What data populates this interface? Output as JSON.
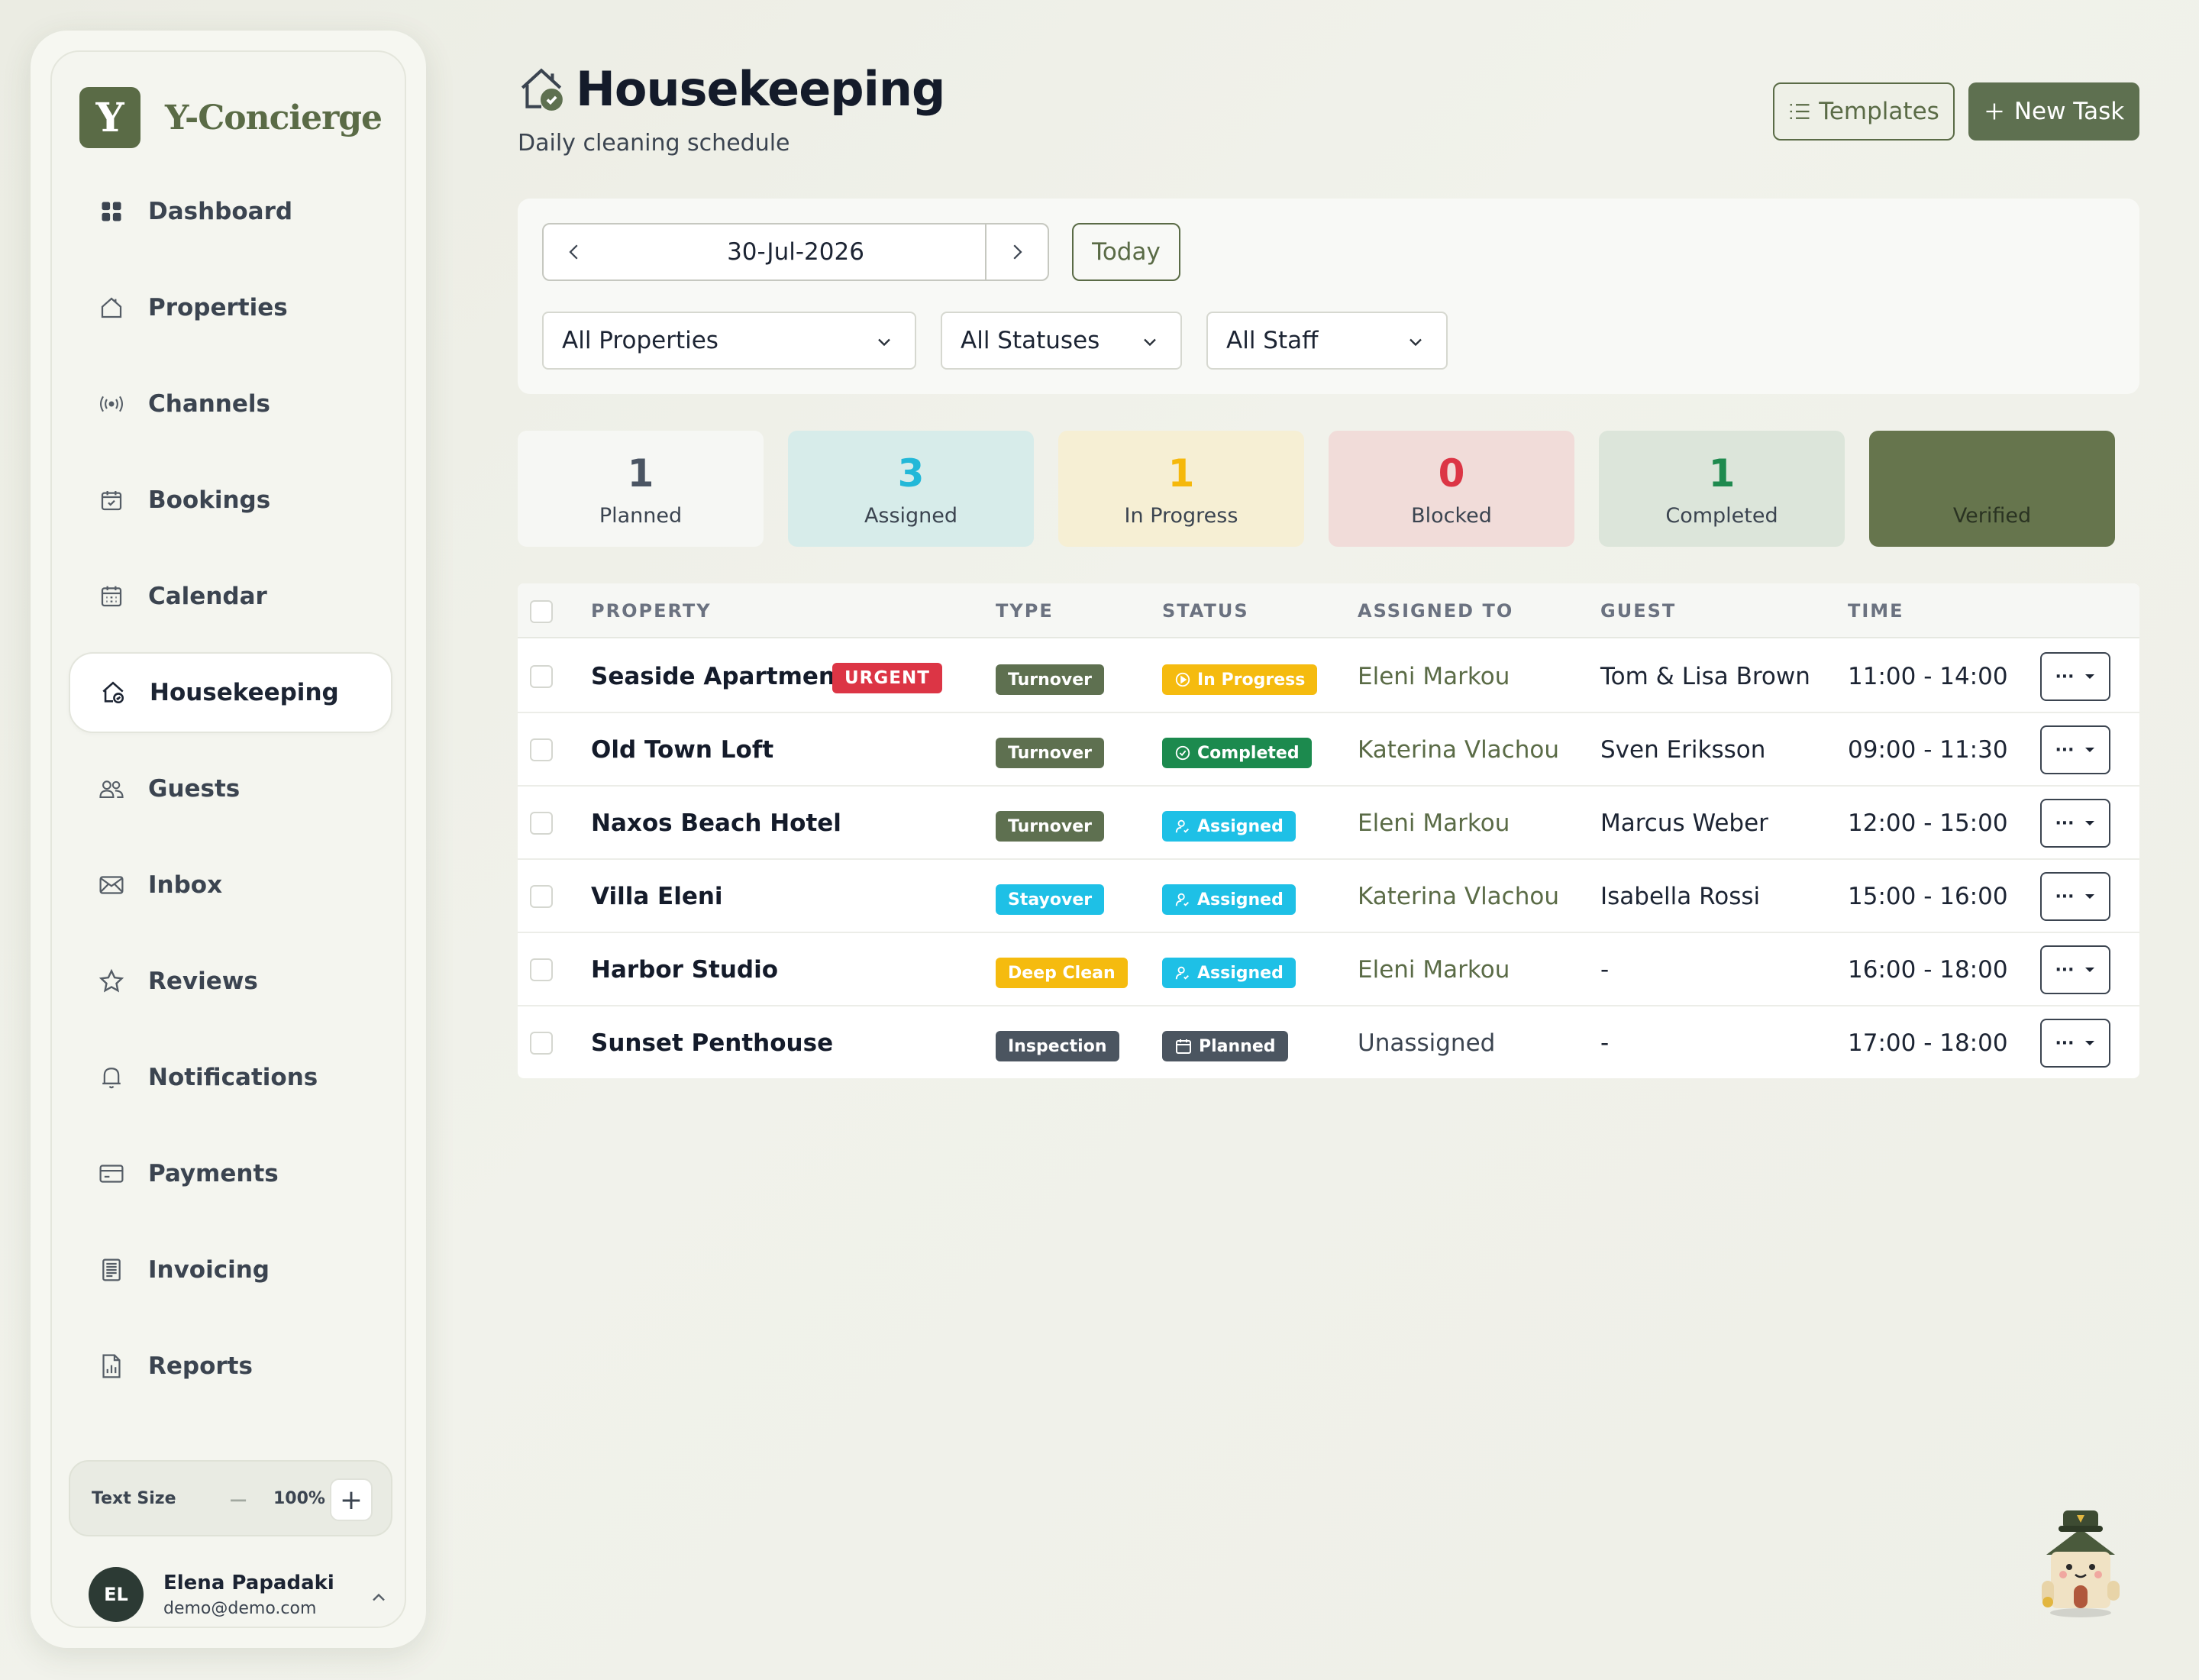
{
  "brand": {
    "logo_letter": "Y",
    "name": "Y-Concierge",
    "color": "#5a6b46"
  },
  "nav": {
    "items": [
      {
        "label": "Dashboard",
        "icon": "grid-icon"
      },
      {
        "label": "Properties",
        "icon": "house-icon"
      },
      {
        "label": "Channels",
        "icon": "broadcast-icon"
      },
      {
        "label": "Bookings",
        "icon": "calendar-check-icon"
      },
      {
        "label": "Calendar",
        "icon": "calendar-icon"
      },
      {
        "label": "Housekeeping",
        "icon": "house-clean-icon",
        "active": true
      },
      {
        "label": "Guests",
        "icon": "users-icon"
      },
      {
        "label": "Inbox",
        "icon": "mail-icon"
      },
      {
        "label": "Reviews",
        "icon": "star-icon"
      },
      {
        "label": "Notifications",
        "icon": "bell-icon"
      },
      {
        "label": "Payments",
        "icon": "credit-card-icon"
      },
      {
        "label": "Invoicing",
        "icon": "invoice-icon"
      },
      {
        "label": "Reports",
        "icon": "report-icon"
      }
    ]
  },
  "text_size": {
    "label": "Text Size",
    "minus": "−",
    "value": "100%",
    "plus": "+"
  },
  "user": {
    "initials": "EL",
    "name": "Elena Papadaki",
    "email": "demo@demo.com"
  },
  "header": {
    "title": "Housekeeping",
    "subtitle": "Daily cleaning schedule",
    "templates_label": "Templates",
    "new_task_label": "New Task"
  },
  "filters": {
    "date": "30-Jul-2026",
    "today_label": "Today",
    "property": "All Properties",
    "status": "All Statuses",
    "staff": "All Staff"
  },
  "stats": [
    {
      "count": "1",
      "label": "Planned",
      "bg": "#f6f7f4",
      "color": "#4b5563"
    },
    {
      "count": "3",
      "label": "Assigned",
      "bg": "#d7ecea",
      "color": "#22b8d8"
    },
    {
      "count": "1",
      "label": "In Progress",
      "bg": "#f6efd4",
      "color": "#f5b80b"
    },
    {
      "count": "0",
      "label": "Blocked",
      "bg": "#f1dcd9",
      "color": "#dc3545"
    },
    {
      "count": "1",
      "label": "Completed",
      "bg": "#dce5da",
      "color": "#1f8a4f"
    },
    {
      "count": "",
      "label": "Verified",
      "bg": "#66754d",
      "color": "#ffffff"
    }
  ],
  "table": {
    "columns": [
      "PROPERTY",
      "TYPE",
      "STATUS",
      "ASSIGNED TO",
      "GUEST",
      "TIME"
    ],
    "urgent_label": "URGENT",
    "rows": [
      {
        "property": "Seaside Apartment",
        "urgent": true,
        "type": "Turnover",
        "type_color": "#5e7050",
        "status": "In Progress",
        "status_color": "#f5bb0f",
        "status_icon": "play-circle-icon",
        "assigned": "Eleni Markou",
        "guest": "Tom & Lisa Brown",
        "time": "11:00 - 14:00"
      },
      {
        "property": "Old Town Loft",
        "urgent": false,
        "type": "Turnover",
        "type_color": "#5e7050",
        "status": "Completed",
        "status_color": "#1c8a4e",
        "status_icon": "check-circle-icon",
        "assigned": "Katerina Vlachou",
        "guest": "Sven Eriksson",
        "time": "09:00 - 11:30"
      },
      {
        "property": "Naxos Beach Hotel",
        "urgent": false,
        "type": "Turnover",
        "type_color": "#5e7050",
        "status": "Assigned",
        "status_color": "#1ec0e6",
        "status_icon": "user-check-icon",
        "assigned": "Eleni Markou",
        "guest": "Marcus Weber",
        "time": "12:00 - 15:00"
      },
      {
        "property": "Villa Eleni",
        "urgent": false,
        "type": "Stayover",
        "type_color": "#1ec0e6",
        "status": "Assigned",
        "status_color": "#1ec0e6",
        "status_icon": "user-check-icon",
        "assigned": "Katerina Vlachou",
        "guest": "Isabella Rossi",
        "time": "15:00 - 16:00"
      },
      {
        "property": "Harbor Studio",
        "urgent": false,
        "type": "Deep Clean",
        "type_color": "#f5bb0f",
        "status": "Assigned",
        "status_color": "#1ec0e6",
        "status_icon": "user-check-icon",
        "assigned": "Eleni Markou",
        "guest": "-",
        "time": "16:00 - 18:00"
      },
      {
        "property": "Sunset Penthouse",
        "urgent": false,
        "type": "Inspection",
        "type_color": "#4b5560",
        "status": "Planned",
        "status_color": "#4b5560",
        "status_icon": "calendar-icon",
        "assigned": "Unassigned",
        "guest": "-",
        "time": "17:00 - 18:00"
      }
    ],
    "actions_label": "···"
  }
}
